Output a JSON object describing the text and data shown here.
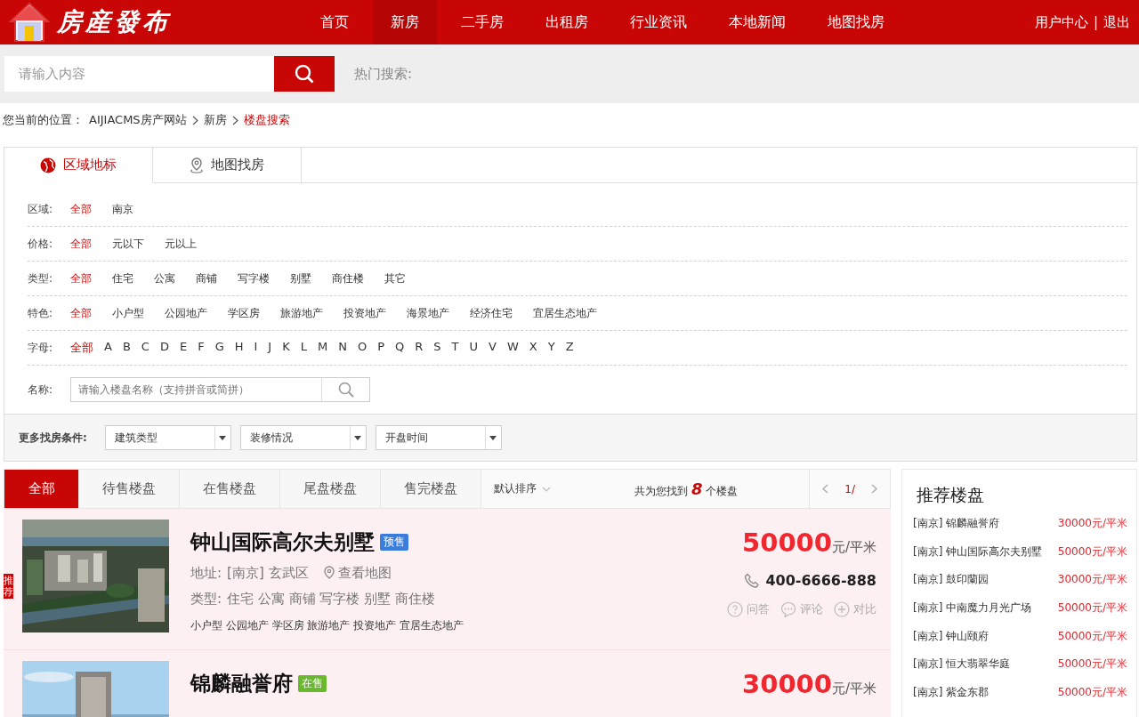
{
  "header": {
    "logo_text": "房産發布",
    "nav": [
      {
        "label": "首页",
        "selected": false
      },
      {
        "label": "新房",
        "selected": true
      },
      {
        "label": "二手房",
        "selected": false
      },
      {
        "label": "出租房",
        "selected": false
      },
      {
        "label": "行业资讯",
        "selected": false
      },
      {
        "label": "本地新闻",
        "selected": false
      },
      {
        "label": "地图找房",
        "selected": false
      }
    ],
    "user_links": [
      "用户中心",
      "退出"
    ],
    "separator": "|"
  },
  "search": {
    "placeholder": "请输入内容",
    "hot_label": "热门搜索:"
  },
  "breadcrumb": {
    "label": "您当前的位置：",
    "items": [
      {
        "text": "AIJIACMS房产网站",
        "current": false
      },
      {
        "text": "新房",
        "current": false
      },
      {
        "text": "楼盘搜索",
        "current": true
      }
    ]
  },
  "filter": {
    "tabs": [
      {
        "label": "区域地标",
        "selected": true
      },
      {
        "label": "地图找房",
        "selected": false
      }
    ],
    "rows": [
      {
        "label": "区域:",
        "options": [
          {
            "text": "全部",
            "selected": true
          },
          {
            "text": "南京",
            "selected": false
          }
        ]
      },
      {
        "label": "价格:",
        "options": [
          {
            "text": "全部",
            "selected": true
          },
          {
            "text": "元以下",
            "selected": false
          },
          {
            "text": "元以上",
            "selected": false
          }
        ]
      },
      {
        "label": "类型:",
        "options": [
          {
            "text": "全部",
            "selected": true
          },
          {
            "text": "住宅",
            "selected": false
          },
          {
            "text": "公寓",
            "selected": false
          },
          {
            "text": "商铺",
            "selected": false
          },
          {
            "text": "写字楼",
            "selected": false
          },
          {
            "text": "别墅",
            "selected": false
          },
          {
            "text": "商住楼",
            "selected": false
          },
          {
            "text": "其它",
            "selected": false
          }
        ]
      },
      {
        "label": "特色:",
        "options": [
          {
            "text": "全部",
            "selected": true
          },
          {
            "text": "小户型",
            "selected": false
          },
          {
            "text": "公园地产",
            "selected": false
          },
          {
            "text": "学区房",
            "selected": false
          },
          {
            "text": "旅游地产",
            "selected": false
          },
          {
            "text": "投资地产",
            "selected": false
          },
          {
            "text": "海景地产",
            "selected": false
          },
          {
            "text": "经济住宅",
            "selected": false
          },
          {
            "text": "宜居生态地产",
            "selected": false
          }
        ]
      },
      {
        "label": "字母:",
        "kind": "letters",
        "options": [
          {
            "text": "全部",
            "selected": true
          },
          {
            "text": "A",
            "selected": false
          },
          {
            "text": "B",
            "selected": false
          },
          {
            "text": "C",
            "selected": false
          },
          {
            "text": "D",
            "selected": false
          },
          {
            "text": "E",
            "selected": false
          },
          {
            "text": "F",
            "selected": false
          },
          {
            "text": "G",
            "selected": false
          },
          {
            "text": "H",
            "selected": false
          },
          {
            "text": "I",
            "selected": false
          },
          {
            "text": "J",
            "selected": false
          },
          {
            "text": "K",
            "selected": false
          },
          {
            "text": "L",
            "selected": false
          },
          {
            "text": "M",
            "selected": false
          },
          {
            "text": "N",
            "selected": false
          },
          {
            "text": "O",
            "selected": false
          },
          {
            "text": "P",
            "selected": false
          },
          {
            "text": "Q",
            "selected": false
          },
          {
            "text": "R",
            "selected": false
          },
          {
            "text": "S",
            "selected": false
          },
          {
            "text": "T",
            "selected": false
          },
          {
            "text": "U",
            "selected": false
          },
          {
            "text": "V",
            "selected": false
          },
          {
            "text": "W",
            "selected": false
          },
          {
            "text": "X",
            "selected": false
          },
          {
            "text": "Y",
            "selected": false
          },
          {
            "text": "Z",
            "selected": false
          }
        ]
      }
    ],
    "name_field": {
      "label": "名称:",
      "placeholder": "请输入楼盘名称（支持拼音或简拼）"
    },
    "more": {
      "label": "更多找房条件:",
      "selects": [
        "建筑类型",
        "装修情况",
        "开盘时间"
      ]
    }
  },
  "results": {
    "tabs": [
      {
        "label": "全部",
        "selected": true
      },
      {
        "label": "待售楼盘",
        "selected": false
      },
      {
        "label": "在售楼盘",
        "selected": false
      },
      {
        "label": "尾盘楼盘",
        "selected": false
      },
      {
        "label": "售完楼盘",
        "selected": false
      }
    ],
    "sort": "默认排序",
    "count_prefix": "共为您找到",
    "count": "8",
    "count_suffix": "个楼盘",
    "page": "1/",
    "listings": [
      {
        "tag": "推荐",
        "title": "钟山国际高尔夫别墅",
        "status": "预售",
        "color": "#3b7ddd",
        "address_label": "地址:",
        "address": "[南京] 玄武区",
        "map_link": "查看地图",
        "type_label": "类型:",
        "types": "住宅 公寓 商铺 写字楼 别墅 商住楼",
        "features": "小户型 公园地产 学区房 旅游地产 投资地产 宜居生态地产",
        "price": "50000",
        "unit": "元/平米",
        "phone": "400-6666-888",
        "actions": [
          {
            "kind": "question",
            "label": "问答"
          },
          {
            "kind": "comment",
            "label": "评论"
          },
          {
            "kind": "compare",
            "label": "对比"
          }
        ]
      },
      {
        "title": "锦麟融誉府",
        "status": "在售",
        "color": "#6ab82e",
        "price": "30000",
        "unit": "元/平米"
      }
    ]
  },
  "sidebar": {
    "title": "推荐楼盘",
    "items": [
      {
        "name": "[南京] 锦麟融誉府",
        "price": "30000元/平米"
      },
      {
        "name": "[南京] 钟山国际高尔夫别墅",
        "price": "50000元/平米"
      },
      {
        "name": "[南京] 鼓印蘭园",
        "price": "30000元/平米"
      },
      {
        "name": "[南京] 中南魔力月光广场",
        "price": "50000元/平米"
      },
      {
        "name": "[南京] 钟山颐府",
        "price": "50000元/平米"
      },
      {
        "name": "[南京] 恒大翡翠华庭",
        "price": "50000元/平米"
      },
      {
        "name": "[南京] 紫金东郡",
        "price": "50000元/平米"
      }
    ]
  }
}
